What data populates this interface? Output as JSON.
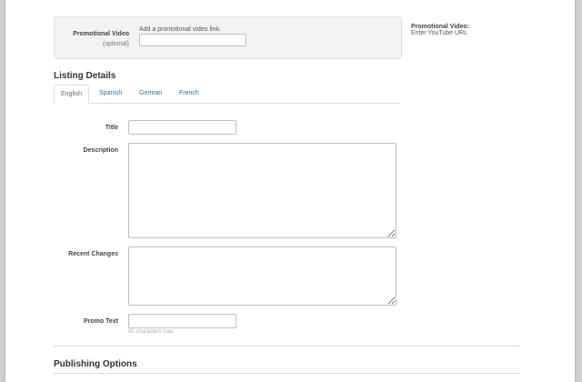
{
  "promo_video": {
    "label": "Promotional Video",
    "optional": "(optional)",
    "hint": "Add a promotional video link:",
    "value": "",
    "side_title": "Promotional Video:",
    "side_sub": "Enter YouTube URL"
  },
  "listing": {
    "heading": "Listing Details",
    "tabs": [
      {
        "label": "English",
        "active": true
      },
      {
        "label": "Spanish",
        "active": false
      },
      {
        "label": "German",
        "active": false
      },
      {
        "label": "French",
        "active": false
      }
    ],
    "fields": {
      "title_label": "Title",
      "title_value": "",
      "description_label": "Description",
      "description_value": "",
      "recent_changes_label": "Recent Changes",
      "recent_changes_value": "",
      "promo_text_label": "Promo Text",
      "promo_text_value": "",
      "promo_text_hint": "80 characters max"
    }
  },
  "publishing": {
    "heading": "Publishing Options"
  }
}
